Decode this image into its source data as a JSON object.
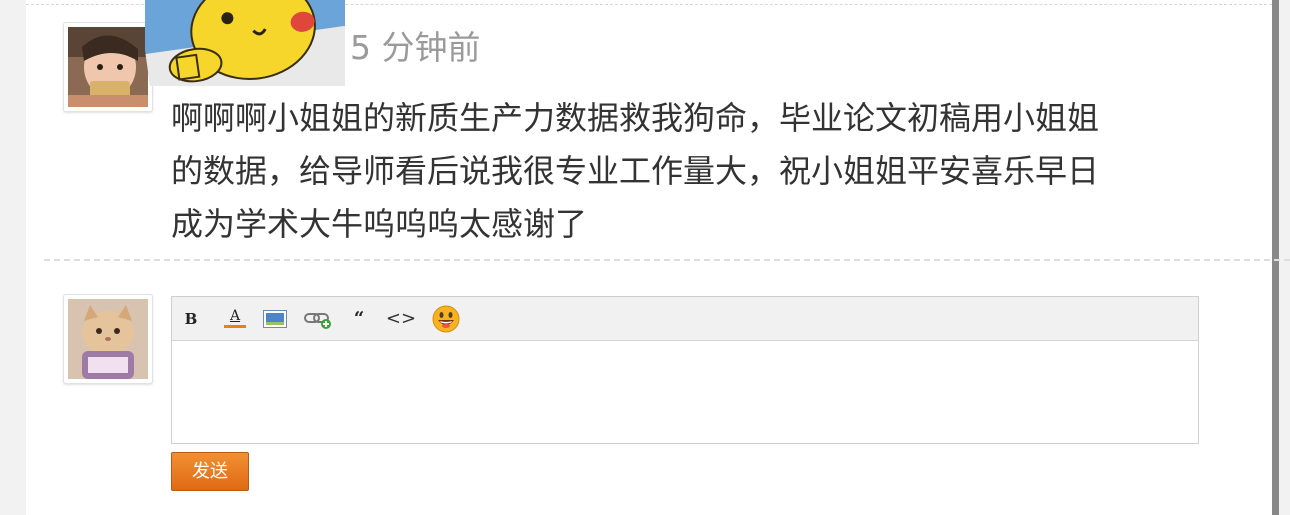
{
  "comment": {
    "timestamp": "5 分钟前",
    "lines": [
      "啊啊啊小姐姐的新质生产力数据救我狗命，毕业论文初稿用小姐姐",
      "的数据，给导师看后说我很专业工作量大，祝小姐姐平安喜乐早日",
      "成为学术大牛呜呜呜太感谢了"
    ]
  },
  "reply": {
    "toolbar": {
      "bold": "B",
      "font_color": "A",
      "icons": [
        "bold-icon",
        "font-color-icon",
        "image-icon",
        "link-icon",
        "quote-icon",
        "code-icon",
        "emoji-icon"
      ]
    },
    "input_value": "",
    "send_label": "发送"
  },
  "colors": {
    "send_button": "#e87a1f",
    "timestamp": "#9a9a9a",
    "text": "#333333"
  }
}
